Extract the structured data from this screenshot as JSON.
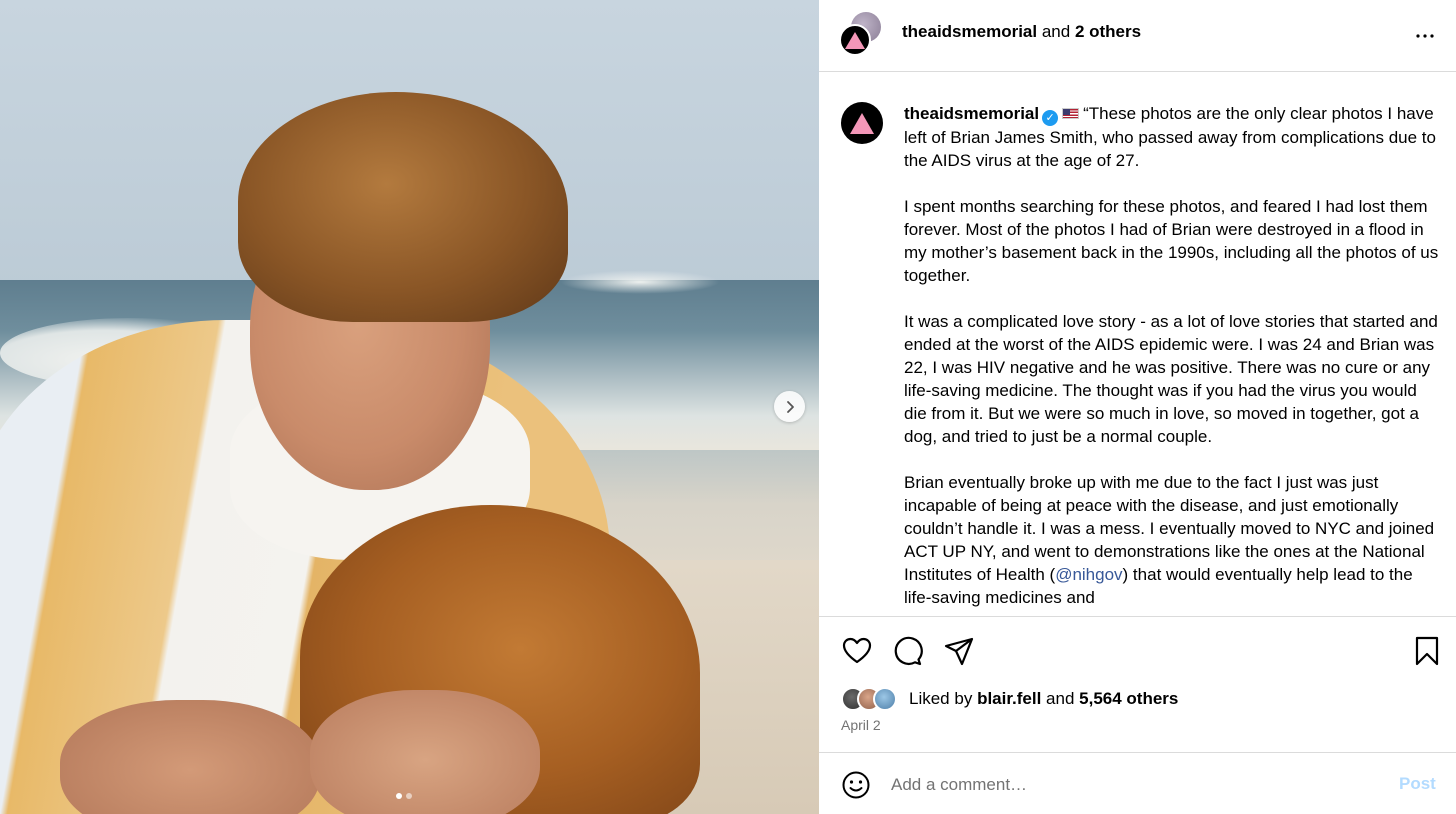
{
  "photo": {
    "alt": "",
    "carousel": {
      "total": 2,
      "current": 1
    }
  },
  "header": {
    "username": "theaidsmemorial",
    "and": "and",
    "others": "2 others",
    "more_icon": "more-horizontal-icon"
  },
  "caption": {
    "username": "theaidsmemorial",
    "opening": "“These photos are the only clear photos I have left of Brian James Smith, who passed away from complications due to the AIDS virus at the age of 27.",
    "p2": "I spent months searching for these photos, and feared I had lost them forever. Most of the photos I had of Brian were destroyed in a flood in my mother’s basement back in the 1990s, including all the photos of us together.",
    "p3": "It was a complicated love story - as a lot of love stories that started and ended at the worst of the AIDS epidemic were. I was 24 and Brian was 22, I was HIV negative and he was positive. There was no cure or any life-saving medicine. The thought was if you had the virus you would die from it. But we were so much in love, so moved in together, got a dog, and tried to just be a normal couple.",
    "p4_before": "Brian eventually broke up with me due to the fact I just was just incapable of being at peace with the disease, and just emotionally couldn’t handle it. I was a mess. I eventually moved to NYC and joined ACT UP NY, and went to demonstrations like the ones at the National Institutes of Health (",
    "p4_mention": "@nihgov",
    "p4_after": ") that would eventually help lead to the life-saving medicines and"
  },
  "actions": {
    "like_icon": "heart-icon",
    "comment_icon": "comment-icon",
    "share_icon": "share-icon",
    "save_icon": "bookmark-icon"
  },
  "likes": {
    "prefix": "Liked by",
    "user": "blair.fell",
    "and": "and",
    "count": "5,564 others"
  },
  "date": "April 2",
  "comment": {
    "placeholder": "Add a comment…",
    "post_label": "Post",
    "emoji_icon": "emoji-icon"
  },
  "colors": {
    "accent": "#0095f6",
    "post_disabled": "#b3dbff",
    "mention": "#385898",
    "divider": "#dbdbdb",
    "secondary_text": "#737373"
  }
}
